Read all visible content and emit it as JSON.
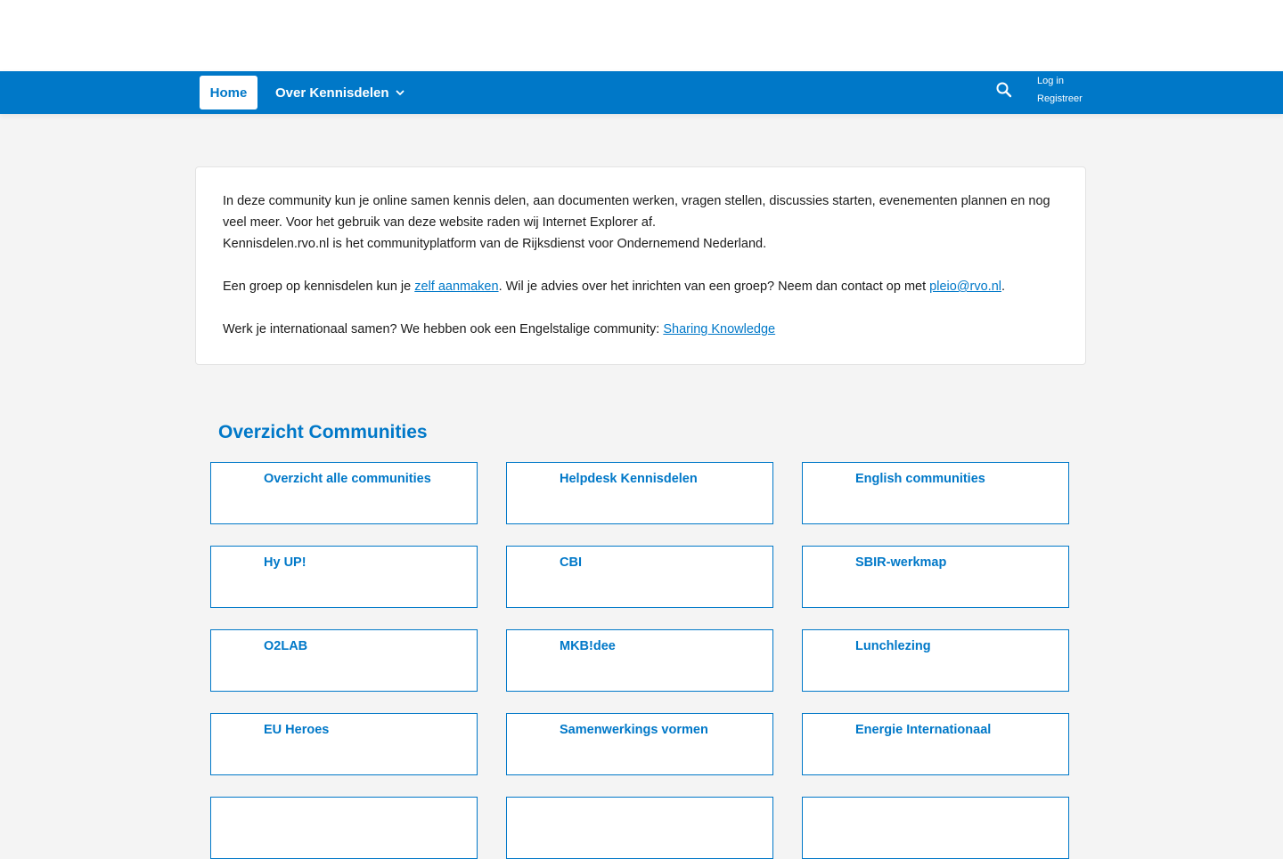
{
  "nav": {
    "home_label": "Home",
    "about_label": "Over Kennisdelen",
    "login_label": "Log in",
    "register_label": "Registreer"
  },
  "intro": {
    "line1": "In deze community kun je online samen kennis delen, aan documenten werken, vragen stellen, discussies starten, evenementen plannen en nog veel meer. Voor het gebruik van deze website raden wij Internet Explorer af.",
    "line2": "Kennisdelen.rvo.nl is het communityplatform van de Rijksdienst voor Ondernemend Nederland.",
    "group_prefix": "Een groep op kennisdelen kun je ",
    "group_link": "zelf aanmaken",
    "group_middle": ". Wil je advies over het inrichten van een groep? Neem dan contact op met ",
    "email_link": "pleio@rvo.nl",
    "group_suffix": ".",
    "intl_prefix": "Werk je internationaal samen? We hebben ook een Engelstalige community: ",
    "intl_link": "Sharing Knowledge"
  },
  "communities": {
    "title": "Overzicht Communities",
    "items": [
      "Overzicht alle communities",
      "Helpdesk Kennisdelen",
      "English communities",
      "Hy UP!",
      "CBI",
      "SBIR-werkmap",
      "O2LAB",
      "MKB!dee",
      "Lunchlezing",
      "EU Heroes",
      "Samenwerkings vormen",
      "Energie Internationaal"
    ]
  },
  "colors": {
    "brand": "#0078c8",
    "background": "#f4f4f4",
    "card": "#ffffff"
  },
  "icons": {
    "search": "search-icon",
    "dropdown": "chevron-down-icon"
  }
}
